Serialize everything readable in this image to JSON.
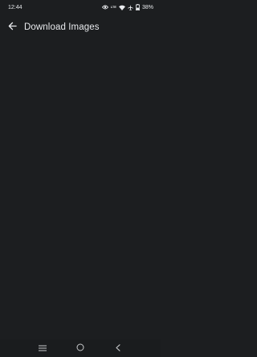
{
  "status_bar": {
    "time": "12:44",
    "network_top": "LTE",
    "network_bottom": "",
    "battery": "38%"
  },
  "app_bar": {
    "title": "Download Images"
  },
  "colors": {
    "background": "#1c1e20",
    "text": "#e8eaed"
  }
}
